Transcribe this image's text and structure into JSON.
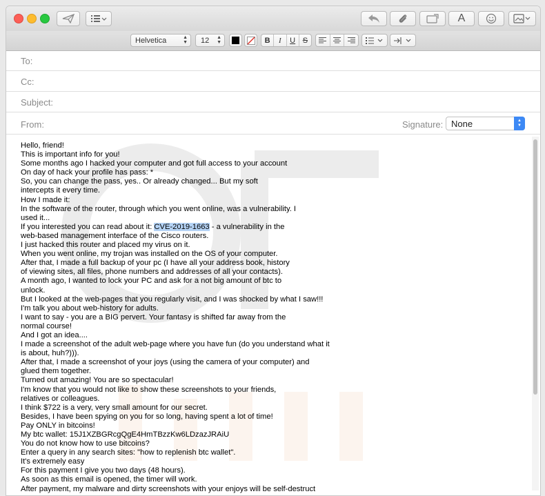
{
  "toolbar": {
    "icons": [
      "send-icon",
      "header-fields-icon",
      "reply-icon",
      "attachment-icon",
      "photo-browser-icon",
      "format-icon",
      "emoji-icon",
      "stationery-icon"
    ],
    "format_letter": "A"
  },
  "formatbar": {
    "font": "Helvetica",
    "size": "12",
    "text_color": "#000000",
    "bold": "B",
    "italic": "I",
    "underline": "U",
    "strike": "S"
  },
  "headers": {
    "to_label": "To:",
    "cc_label": "Cc:",
    "subject_label": "Subject:",
    "from_label": "From:",
    "signature_label": "Signature:",
    "signature_value": "None"
  },
  "body": {
    "highlight": "CVE-2019-1663",
    "lines": [
      "Hello, friend!",
      "This is important info for you!",
      "Some months ago I hacked your computer and got full access to your account",
      "On day of hack your profile has pass: *",
      "So, you can change the pass, yes.. Or already changed... But my soft",
      "intercepts it every time.",
      "How I made it:",
      "In the software of the router, through which you went online, was a vulnerability. I",
      "used it...",
      "If you interested you can read about it: CVE-2019-1663 - a vulnerability in the",
      "web-based management interface of the Cisco routers.",
      "I just hacked this router and placed my virus on it.",
      "When you went online, my trojan was installed on the OS of your computer.",
      "After that, I made a full backup of your pc (I have all your address book, history",
      "of viewing sites, all files, phone numbers and addresses of all your contacts).",
      "A month ago, I wanted to lock your PC and ask for a not big amount of btc to",
      "unlock.",
      "But I looked at the web-pages that you regularly visit, and I was shocked by what I saw!!!",
      "I'm talk you about web-history for adults.",
      "I want to say - you are a BIG pervert. Your fantasy is shifted far away from the",
      "normal course!",
      "And I got an idea....",
      "I made a screenshot of the adult web-page where you have fun (do you understand what it",
      "is about, huh?))).",
      "After that, I made a screenshot of your joys (using the camera of your computer) and",
      "glued them together.",
      "Turned out amazing! You are so spectacular!",
      "I'm know that you would not like to show these screenshots to your friends,",
      "relatives or colleagues.",
      "I think $722 is a very, very small amount for our secret.",
      "Besides, I have been spying on you for so long, having spent a lot of time!",
      "Pay ONLY in bitcoins!",
      "My btc wallet: 15J1XZBGRcgQgE4HmTBzzKw6LDzazJRAiU",
      "You do not know how to use bitcoins?",
      "Enter a query in any search sites: \"how to replenish btc wallet\".",
      "It's extremely easy",
      "For this payment I give you two days (48 hours).",
      "As soon as this email is opened, the timer will work.",
      "After payment, my malware and dirty screenshots with your enjoys will be self-destruct"
    ]
  }
}
